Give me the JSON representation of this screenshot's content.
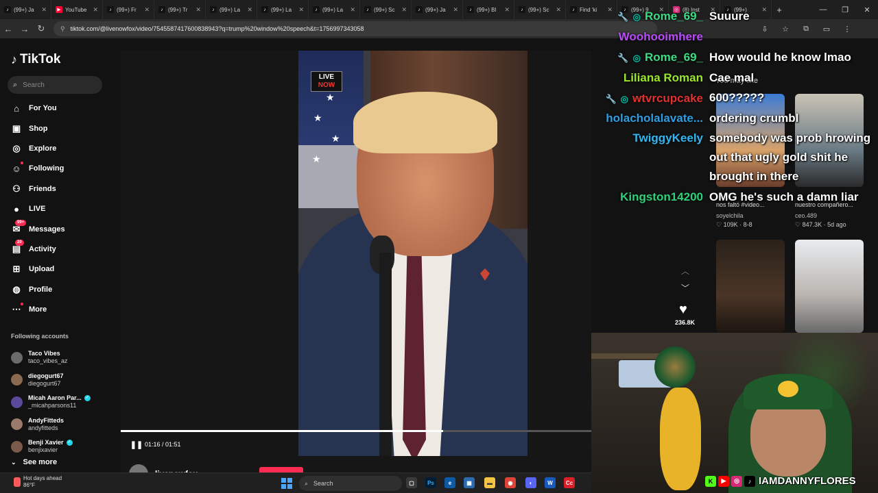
{
  "browser": {
    "tabs": [
      {
        "label": "(99+) Ja",
        "icon": "tiktok-icon"
      },
      {
        "label": "YouTube",
        "icon": "youtube-icon"
      },
      {
        "label": "(99+) Fr",
        "icon": "tiktok-icon"
      },
      {
        "label": "(99+) Tr",
        "icon": "tiktok-icon"
      },
      {
        "label": "(99+) La",
        "icon": "tiktok-icon"
      },
      {
        "label": "(99+) La",
        "icon": "tiktok-icon"
      },
      {
        "label": "(99+) La",
        "icon": "tiktok-icon"
      },
      {
        "label": "(99+) Sc",
        "icon": "tiktok-icon"
      },
      {
        "label": "(99+) Ja",
        "icon": "tiktok-icon"
      },
      {
        "label": "(99+) Bl",
        "icon": "tiktok-icon"
      },
      {
        "label": "(99+) Sc",
        "icon": "tiktok-icon"
      },
      {
        "label": "Find 'ki",
        "icon": "tiktok-icon"
      },
      {
        "label": "(99+) 9",
        "icon": "tiktok-icon"
      },
      {
        "label": "(8) Inst",
        "icon": "instagram-icon"
      },
      {
        "label": "(99+)",
        "icon": "tiktok-icon"
      }
    ],
    "new_tab": "+",
    "url": "tiktok.com/@livenowfox/video/7545587417600838943?q=trump%20window%20speech&t=1756997343058"
  },
  "tiktok": {
    "logo": "TikTok",
    "search_placeholder": "Search",
    "nav": [
      {
        "label": "For You",
        "icon": "home-icon"
      },
      {
        "label": "Shop",
        "icon": "shop-icon"
      },
      {
        "label": "Explore",
        "icon": "compass-icon"
      },
      {
        "label": "Following",
        "icon": "following-icon"
      },
      {
        "label": "Friends",
        "icon": "friends-icon"
      },
      {
        "label": "LIVE",
        "icon": "live-icon"
      },
      {
        "label": "Messages",
        "icon": "messages-icon",
        "badge": "99+"
      },
      {
        "label": "Activity",
        "icon": "activity-icon",
        "badge": "20"
      },
      {
        "label": "Upload",
        "icon": "upload-icon"
      },
      {
        "label": "Profile",
        "icon": "profile-icon"
      },
      {
        "label": "More",
        "icon": "more-icon"
      }
    ],
    "following_header": "Following accounts",
    "accounts": [
      {
        "name": "Taco Vibes",
        "handle": "taco_vibes_az",
        "verified": false
      },
      {
        "name": "diegogurt67",
        "handle": "diegogurt67",
        "verified": false
      },
      {
        "name": "Micah Aaron Par...",
        "handle": "_micahparsons11",
        "verified": true
      },
      {
        "name": "AndyFitteds",
        "handle": "andyfitteds",
        "verified": false
      },
      {
        "name": "Benji Xavier",
        "handle": "benjixavier",
        "verified": true
      }
    ],
    "see_more": "See more",
    "player": {
      "time": "01:16 / 01:51",
      "progress": 0.685,
      "author": "livenowfox",
      "likes": "236.8K",
      "channel_logo_top": "LIVE",
      "channel_logo_bottom": "NOW"
    },
    "recommended": {
      "header": "You may like",
      "cards": [
        {
          "title": "nos faltó #video...",
          "user": "soyelchila",
          "stats": "109K · 8-8"
        },
        {
          "title": "nuestro compañero...",
          "user": "ceo.489",
          "stats": "847.3K · 5d ago"
        },
        {
          "title": "",
          "user": "",
          "stats": ""
        },
        {
          "title": "",
          "user": "",
          "stats": ""
        }
      ]
    }
  },
  "chat": {
    "names": [
      {
        "name": "Rome_69_",
        "color": "#3ddc84",
        "wrench": true
      },
      {
        "name": "Woohooimhere",
        "color": "#b64cf5",
        "wrench": false
      },
      {
        "name": "Rome_69_",
        "color": "#3ddc84",
        "wrench": true
      },
      {
        "name": "Liliana Roman",
        "color": "#9ae62e",
        "wrench": false
      },
      {
        "name": "wtvrcupcake",
        "color": "#e0312f",
        "wrench": true
      },
      {
        "name": "holacholalavate...",
        "color": "#2f9de0",
        "wrench": false
      },
      {
        "name": "TwiggyKeely",
        "color": "#34b7f1",
        "wrench": false
      },
      {
        "name": "Kingston14200",
        "color": "#2fd17a",
        "wrench": false
      }
    ],
    "messages": [
      "Suuure",
      "How would he know lmao",
      "Cae mal",
      "600?????",
      "ordering crumbl",
      "somebody was prob hrowing",
      "out that ugly gold shit he",
      "brought in there",
      "OMG he's such a damn liar"
    ]
  },
  "stream": {
    "handle": "IAMDANNYFLORES"
  },
  "taskbar": {
    "weather_title": "Hot days ahead",
    "weather_temp": "86°F",
    "search": "Search"
  }
}
